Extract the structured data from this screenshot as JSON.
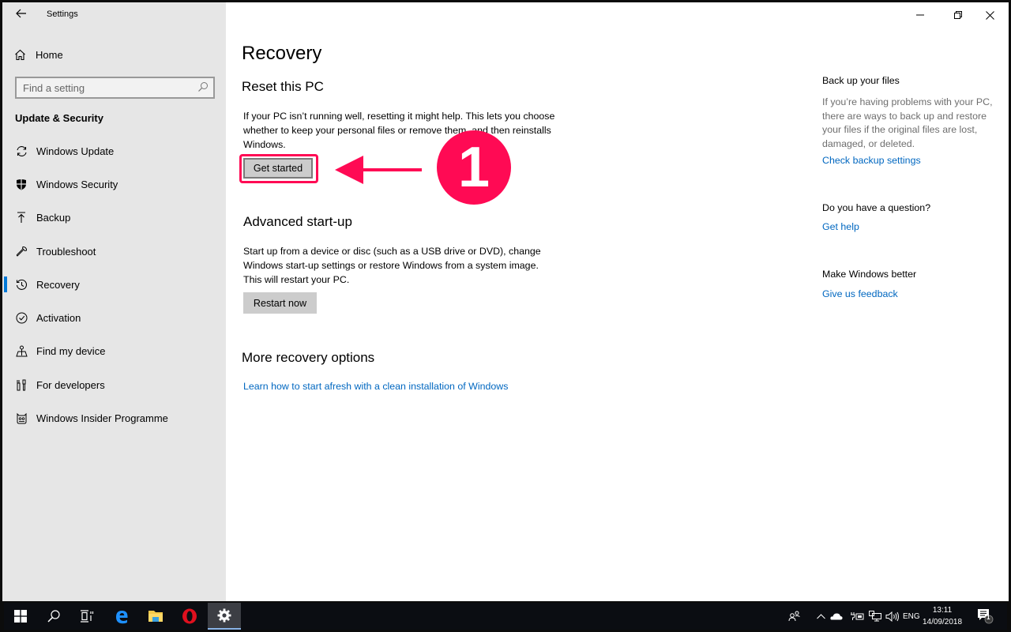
{
  "window": {
    "title": "Settings",
    "controls": {
      "minimize": "minimize",
      "restore": "restore",
      "close": "close"
    }
  },
  "sidebar": {
    "home_label": "Home",
    "search_placeholder": "Find a setting",
    "section_title": "Update & Security",
    "items": [
      {
        "label": "Windows Update",
        "icon": "sync-icon",
        "active": false
      },
      {
        "label": "Windows Security",
        "icon": "shield-icon",
        "active": false
      },
      {
        "label": "Backup",
        "icon": "upload-icon",
        "active": false
      },
      {
        "label": "Troubleshoot",
        "icon": "wrench-icon",
        "active": false
      },
      {
        "label": "Recovery",
        "icon": "history-icon",
        "active": true
      },
      {
        "label": "Activation",
        "icon": "check-circle-icon",
        "active": false
      },
      {
        "label": "Find my device",
        "icon": "find-device-icon",
        "active": false
      },
      {
        "label": "For developers",
        "icon": "developer-tools-icon",
        "active": false
      },
      {
        "label": "Windows Insider Programme",
        "icon": "insider-cat-icon",
        "active": false
      }
    ]
  },
  "main": {
    "title": "Recovery",
    "reset": {
      "heading": "Reset this PC",
      "description": "If your PC isn’t running well, resetting it might help. This lets you choose whether to keep your personal files or remove them, and then reinstalls Windows.",
      "button": "Get started"
    },
    "advanced": {
      "heading": "Advanced start-up",
      "description": "Start up from a device or disc (such as a USB drive or DVD), change Windows start-up settings or restore Windows from a system image. This will restart your PC.",
      "button": "Restart now"
    },
    "more": {
      "heading": "More recovery options",
      "link": "Learn how to start afresh with a clean installation of Windows"
    }
  },
  "right_panel": {
    "backup": {
      "heading": "Back up your files",
      "text": "If you’re having problems with your PC, there are ways to back up and restore your files if the original files are lost, damaged, or deleted.",
      "link": "Check backup settings"
    },
    "question": {
      "heading": "Do you have a question?",
      "link": "Get help"
    },
    "feedback": {
      "heading": "Make Windows better",
      "link": "Give us feedback"
    }
  },
  "annotation": {
    "step_number": "1",
    "color": "#ff0a54"
  },
  "taskbar": {
    "apps": [
      "Start",
      "Search",
      "Task View",
      "Microsoft Edge",
      "File Explorer",
      "Opera",
      "Settings"
    ],
    "tray": {
      "language": "ENG",
      "time": "13:11",
      "date": "14/09/2018",
      "notification_count": "1"
    }
  },
  "colors": {
    "accent": "#0078d7",
    "link": "#0067c0",
    "sidebar_bg": "#e6e6e6",
    "taskbar_bg": "#0b0d12"
  }
}
